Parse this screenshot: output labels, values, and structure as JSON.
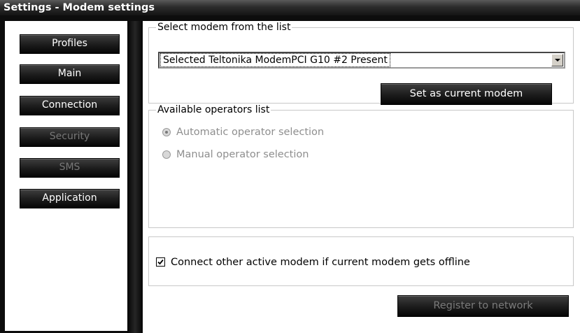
{
  "window": {
    "title": "Settings - Modem settings"
  },
  "sidebar": {
    "items": [
      {
        "label": "Profiles",
        "enabled": true
      },
      {
        "label": "Main",
        "enabled": true
      },
      {
        "label": "Connection",
        "enabled": true
      },
      {
        "label": "Security",
        "enabled": false
      },
      {
        "label": "SMS",
        "enabled": false
      },
      {
        "label": "Application",
        "enabled": true
      }
    ]
  },
  "modem_group": {
    "legend": "Select modem from the list",
    "selected_value": "Selected  Teltonika ModemPCI G10 #2  Present",
    "set_button_label": "Set as current modem"
  },
  "operators_group": {
    "legend": "Available operators list",
    "options": [
      {
        "label": "Automatic operator selection",
        "checked": true,
        "enabled": false
      },
      {
        "label": "Manual operator selection",
        "checked": false,
        "enabled": false
      }
    ],
    "register_button_label": "Register to network",
    "register_enabled": false
  },
  "options_group": {
    "connect_other_label": "Connect other active modem if current modem gets offline",
    "connect_other_checked": true
  },
  "colors": {
    "titlebar": "#2c2c2c",
    "button": "#1e1e1e",
    "disabled_text": "#8e8e8e"
  },
  "icons": {
    "dropdown": "chevron-down-icon",
    "checkbox": "checkmark-icon"
  }
}
